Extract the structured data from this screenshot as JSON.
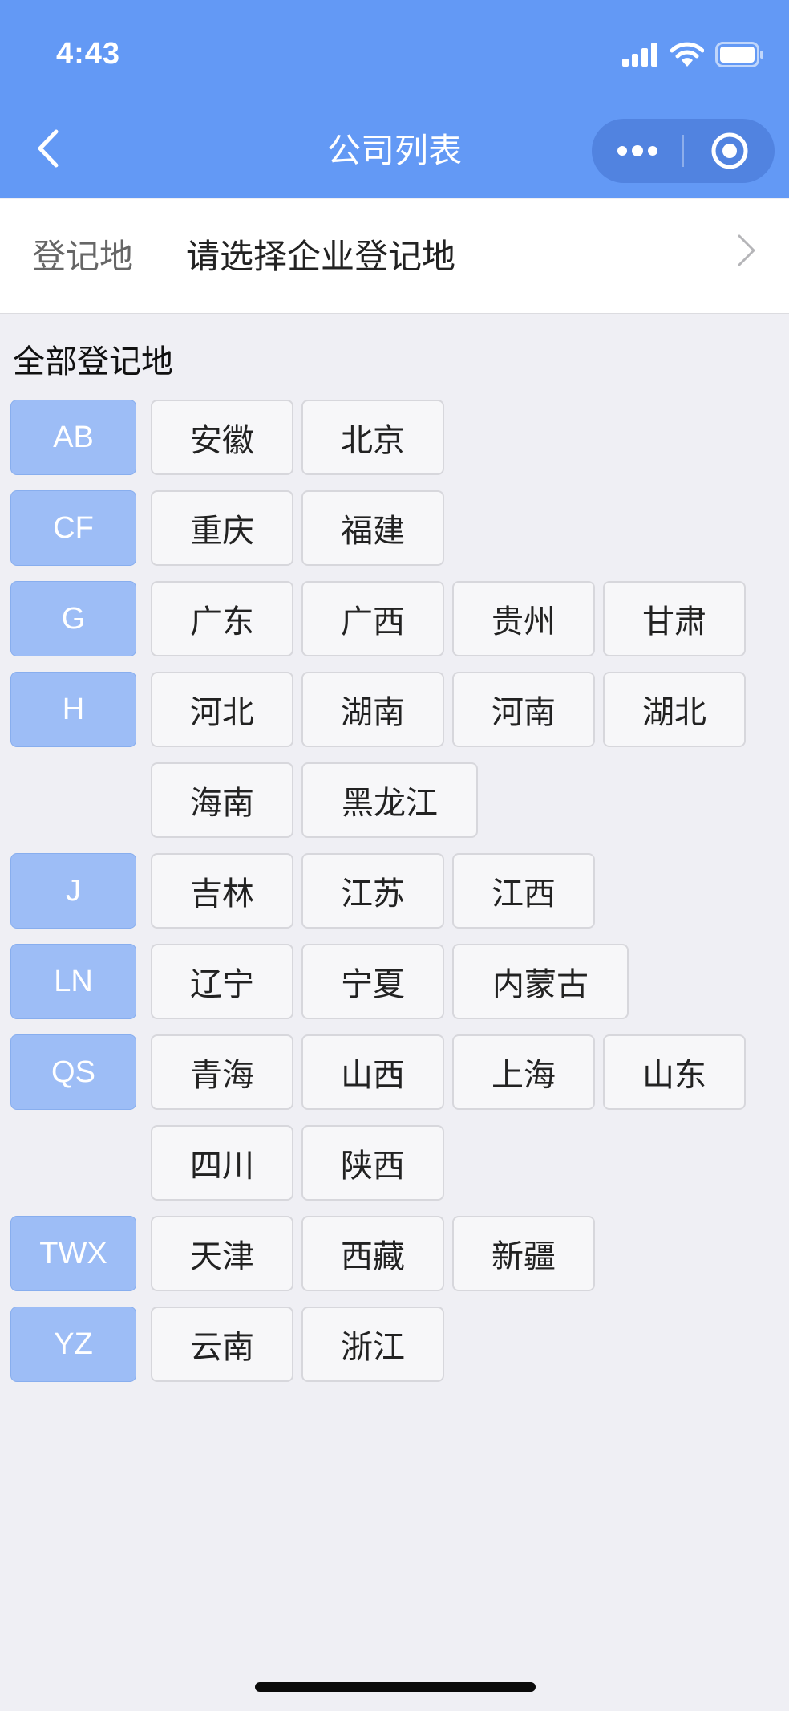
{
  "status_bar": {
    "time": "4:43"
  },
  "nav": {
    "title": "公司列表"
  },
  "registration": {
    "label": "登记地",
    "placeholder": "请选择企业登记地"
  },
  "section": {
    "title": "全部登记地"
  },
  "groups": [
    {
      "tag": "AB",
      "provinces": [
        "安徽",
        "北京"
      ]
    },
    {
      "tag": "CF",
      "provinces": [
        "重庆",
        "福建"
      ]
    },
    {
      "tag": "G",
      "provinces": [
        "广东",
        "广西",
        "贵州",
        "甘肃"
      ]
    },
    {
      "tag": "H",
      "provinces": [
        "河北",
        "湖南",
        "河南",
        "湖北",
        "海南",
        "黑龙江"
      ]
    },
    {
      "tag": "J",
      "provinces": [
        "吉林",
        "江苏",
        "江西"
      ]
    },
    {
      "tag": "LN",
      "provinces": [
        "辽宁",
        "宁夏",
        "内蒙古"
      ]
    },
    {
      "tag": "QS",
      "provinces": [
        "青海",
        "山西",
        "上海",
        "山东",
        "四川",
        "陕西"
      ]
    },
    {
      "tag": "TWX",
      "provinces": [
        "天津",
        "西藏",
        "新疆"
      ]
    },
    {
      "tag": "YZ",
      "provinces": [
        "云南",
        "浙江"
      ]
    }
  ],
  "colors": {
    "header_bg": "#6399f5",
    "tag_bg": "#9dbdf6",
    "chip_bg": "#f7f7f9",
    "page_bg": "#efeff4"
  }
}
